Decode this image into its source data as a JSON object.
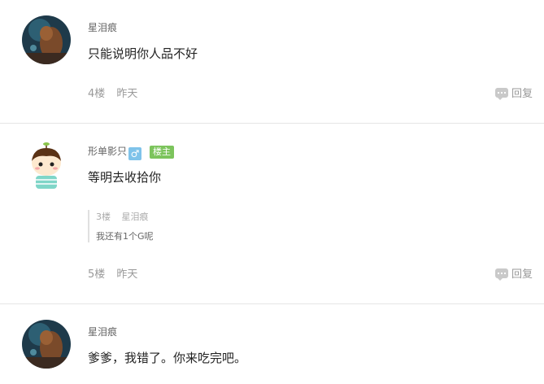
{
  "comments": [
    {
      "username": "星泪痕",
      "text": "只能说明你人品不好",
      "floor": "4楼",
      "time": "昨天",
      "reply_label": "回复"
    },
    {
      "username": "形单影只",
      "gender_symbol": "♂",
      "badge": "楼主",
      "text": "等明去收拾你",
      "quote": {
        "floor": "3楼",
        "username": "星泪痕",
        "text": "我还有1个G呢"
      },
      "floor": "5楼",
      "time": "昨天",
      "reply_label": "回复"
    },
    {
      "username": "星泪痕",
      "text": "爹爹，我错了。你来吃完吧。"
    }
  ],
  "colors": {
    "badge_bg": "#7cc45c",
    "gender_bg": "#7fc3ea",
    "divider": "#e6e6e6"
  }
}
